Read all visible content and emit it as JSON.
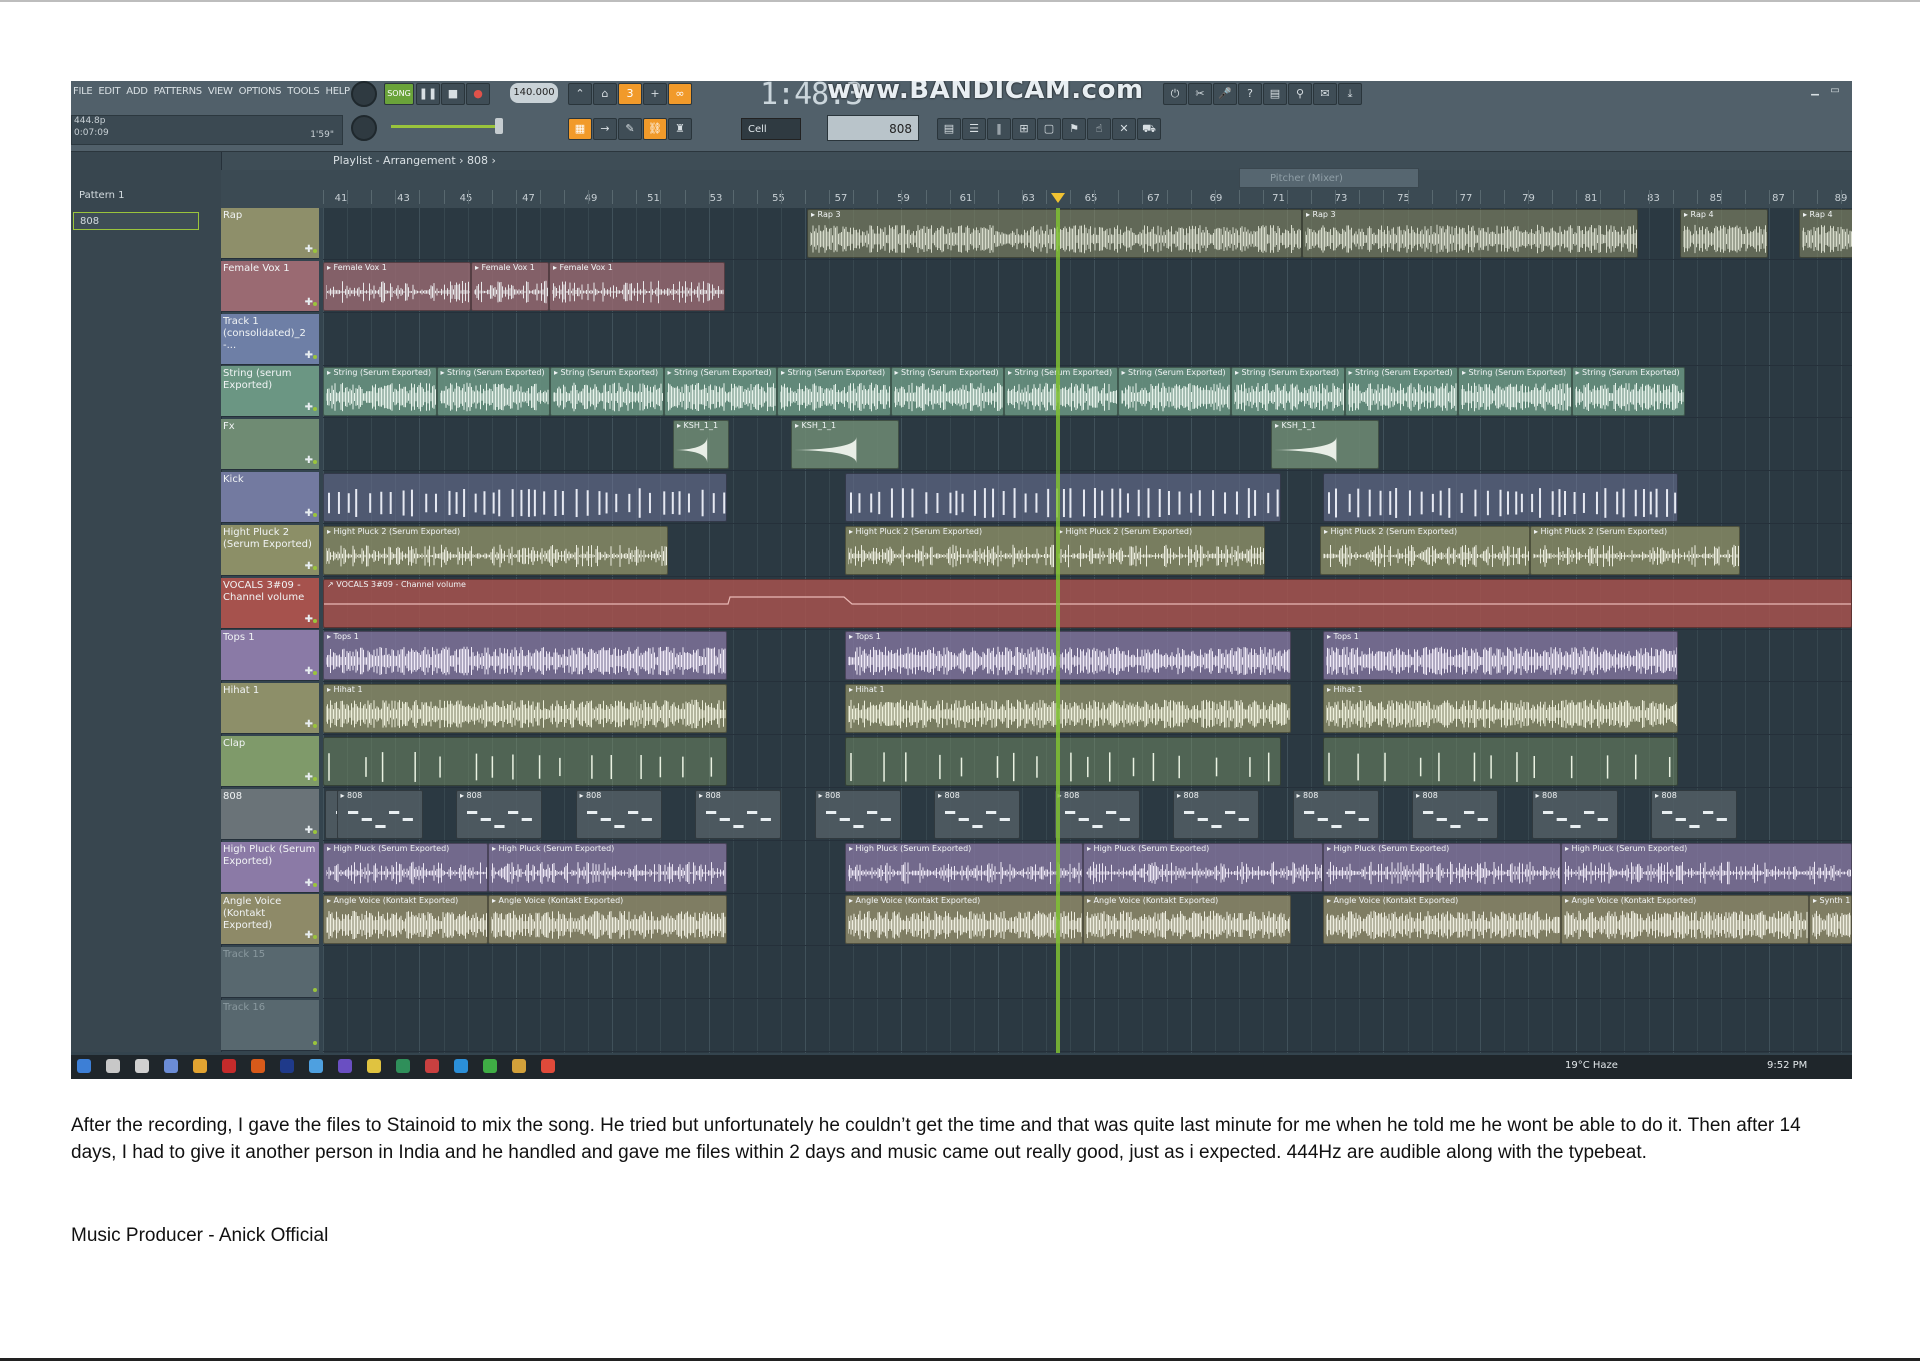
{
  "screenshot": {
    "menu": [
      "FILE",
      "EDIT",
      "ADD",
      "PATTERNS",
      "VIEW",
      "OPTIONS",
      "TOOLS",
      "HELP"
    ],
    "hint_panel": {
      "line1": "444.8p",
      "line2": "0:07:09",
      "time": "1'59\""
    },
    "song_mode": "SONG",
    "tempo": "140.000",
    "clock": "1:48:3",
    "watermark": "www.BANDICAM.com",
    "snap": "Cell",
    "pattern": "808",
    "playlist_title": "Playlist - Arrangement › 808 ›",
    "float_panel": "Pitcher (Mixer)",
    "browser_items": [
      "Pattern 1",
      "808"
    ],
    "ruler": [
      "41",
      "43",
      "45",
      "47",
      "49",
      "51",
      "53",
      "55",
      "57",
      "59",
      "61",
      "63",
      "65",
      "67",
      "69",
      "71",
      "73",
      "75",
      "77",
      "79",
      "81",
      "83",
      "85",
      "87",
      "89"
    ],
    "tracks": [
      {
        "name": "Rap",
        "color": "#8e8f6a"
      },
      {
        "name": "Female Vox 1",
        "color": "#9a6a72"
      },
      {
        "name": "Track 1 (consolidated)_2 -...",
        "color": "#6e7fa6"
      },
      {
        "name": "String (serum Exported)",
        "color": "#6b9683"
      },
      {
        "name": "Fx",
        "color": "#6f8b73"
      },
      {
        "name": "Kick",
        "color": "#737aa0"
      },
      {
        "name": "Hight Pluck 2 (Serum Exported)",
        "color": "#8c8f67"
      },
      {
        "name": "VOCALS 3#09 - Channel volume",
        "color": "#a6524d"
      },
      {
        "name": "Tops 1",
        "color": "#8a7aa6"
      },
      {
        "name": "Hihat 1",
        "color": "#8d8f69"
      },
      {
        "name": "Clap",
        "color": "#7f9a6a"
      },
      {
        "name": "808",
        "color": "#6a7378"
      },
      {
        "name": "High Pluck (Serum Exported)",
        "color": "#8b7aa6"
      },
      {
        "name": "Angle Voice (Kontakt Exported)",
        "color": "#8e8a68"
      },
      {
        "name": "Track 15",
        "color": "#58686f"
      },
      {
        "name": "Track 16",
        "color": "#58686f"
      }
    ],
    "clip_labels": {
      "rap": "Rap 3",
      "rap_4": "Rap 4",
      "female": "Female Vox 1",
      "string": "String (Serum Exported)",
      "fx": "KSH_1_1",
      "hight_pluck": "Hight Pluck 2 (Serum Exported)",
      "vocals": "VOCALS 3#09 - Channel volume",
      "tops": "Tops 1",
      "hihat": "Hihat 1",
      "clip_808": "808",
      "high_pluck": "High Pluck (Serum Exported)",
      "angle": "Angle Voice (Kontakt Exported)",
      "synth": "Synth 1"
    },
    "tray": {
      "weather": "19°C Haze",
      "time": "9:52 PM"
    }
  },
  "caption": "After the recording, I gave the files to Stainoid to mix the song. He tried but unfortunately he couldn’t get the time and that was quite last minute for me when he told me he wont be able to do it. Then after 14 days, I had to give it another person in India and he handled and gave me files within 2 days and music came out really good, just as i expected. 444Hz are audible along with the typebeat.",
  "credit": "Music Producer - Anick Official"
}
